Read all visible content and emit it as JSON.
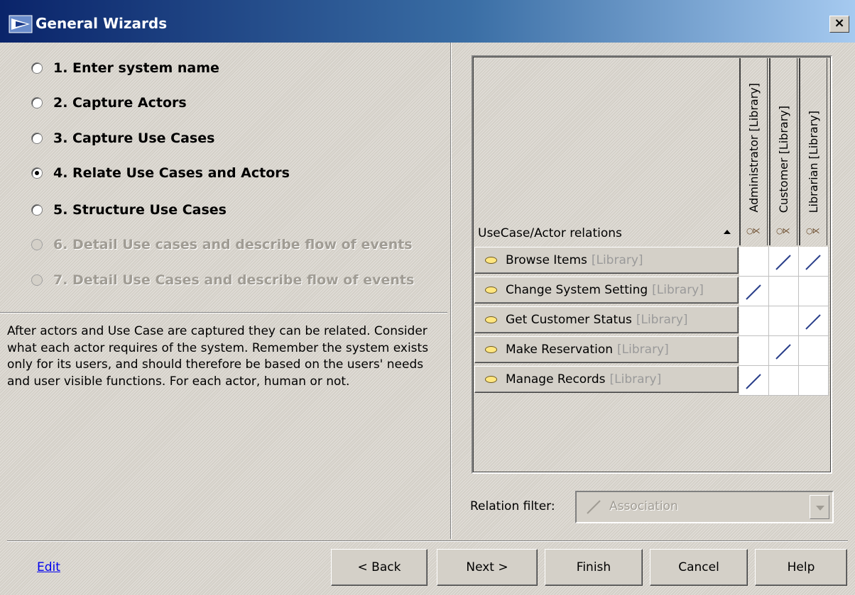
{
  "window": {
    "title": "General Wizards",
    "close_glyph": "×"
  },
  "steps": [
    {
      "label": "1. Enter system name",
      "checked": false,
      "disabled": false
    },
    {
      "label": "2. Capture Actors",
      "checked": false,
      "disabled": false
    },
    {
      "label": "3. Capture Use Cases",
      "checked": false,
      "disabled": false
    },
    {
      "label": "4. Relate Use Cases and Actors",
      "checked": true,
      "disabled": false
    },
    {
      "label": "5. Structure Use Cases",
      "checked": false,
      "disabled": false
    },
    {
      "label": "6. Detail Use cases and describe flow of events",
      "checked": false,
      "disabled": true
    },
    {
      "label": "7. Detail Use Cases and describe flow of events",
      "checked": false,
      "disabled": true
    }
  ],
  "description": "After actors and Use Case are captured they can be related. Consider what each actor requires of the system. Remember the system exists only for its users, and should therefore be based on the users' needs and user visible functions. For each actor, human or not.",
  "matrix": {
    "corner_header": "UseCase/Actor relations",
    "actors": [
      {
        "label": "Administrator [Library]",
        "icon": "actor-icon"
      },
      {
        "label": "Customer [Library]",
        "icon": "actor-icon"
      },
      {
        "label": "Librarian [Library]",
        "icon": "actor-icon"
      }
    ],
    "use_cases": [
      {
        "name": "Browse Items",
        "owner": "[Library]",
        "relations": [
          false,
          true,
          true
        ]
      },
      {
        "name": "Change System Setting",
        "owner": "[Library]",
        "relations": [
          true,
          false,
          false
        ]
      },
      {
        "name": "Get Customer Status",
        "owner": "[Library]",
        "relations": [
          false,
          false,
          true
        ]
      },
      {
        "name": "Make Reservation",
        "owner": "[Library]",
        "relations": [
          false,
          true,
          false
        ]
      },
      {
        "name": "Manage Records",
        "owner": "[Library]",
        "relations": [
          true,
          false,
          false
        ]
      }
    ]
  },
  "filter": {
    "label": "Relation filter:",
    "value": "Association",
    "icon": "association-icon"
  },
  "footer": {
    "edit_link": "Edit",
    "buttons": {
      "back": "< Back",
      "next": "Next >",
      "finish": "Finish",
      "cancel": "Cancel",
      "help": "Help"
    }
  },
  "colors": {
    "title_start": "#0a246a",
    "title_end": "#a6caf0",
    "relation_line": "#2a3f8a",
    "dialog_bg": "#d4d0c8"
  }
}
